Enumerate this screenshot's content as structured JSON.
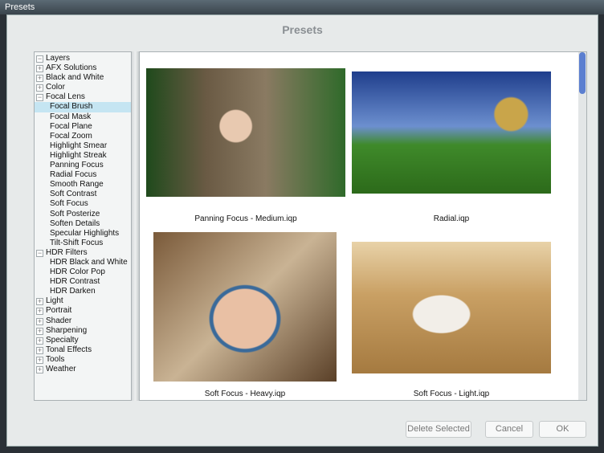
{
  "window": {
    "title": "Presets"
  },
  "dialog": {
    "title": "Presets"
  },
  "tree": [
    {
      "label": "Layers",
      "level": 0,
      "exp": "−"
    },
    {
      "label": "AFX Solutions",
      "level": 0,
      "exp": "+"
    },
    {
      "label": "Black and White",
      "level": 0,
      "exp": "+"
    },
    {
      "label": "Color",
      "level": 0,
      "exp": "+"
    },
    {
      "label": "Focal Lens",
      "level": 0,
      "exp": "−"
    },
    {
      "label": "Focal Brush",
      "level": 1,
      "selected": true
    },
    {
      "label": "Focal Mask",
      "level": 1
    },
    {
      "label": "Focal Plane",
      "level": 1
    },
    {
      "label": "Focal Zoom",
      "level": 1
    },
    {
      "label": "Highlight Smear",
      "level": 1
    },
    {
      "label": "Highlight Streak",
      "level": 1
    },
    {
      "label": "Panning Focus",
      "level": 1
    },
    {
      "label": "Radial Focus",
      "level": 1
    },
    {
      "label": "Smooth Range",
      "level": 1
    },
    {
      "label": "Soft Contrast",
      "level": 1
    },
    {
      "label": "Soft Focus",
      "level": 1
    },
    {
      "label": "Soft Posterize",
      "level": 1
    },
    {
      "label": "Soften Details",
      "level": 1
    },
    {
      "label": "Specular Highlights",
      "level": 1
    },
    {
      "label": "Tilt-Shift Focus",
      "level": 1
    },
    {
      "label": "HDR Filters",
      "level": 0,
      "exp": "−"
    },
    {
      "label": "HDR Black and White",
      "level": 1
    },
    {
      "label": "HDR Color Pop",
      "level": 1
    },
    {
      "label": "HDR Contrast",
      "level": 1
    },
    {
      "label": "HDR Darken",
      "level": 1
    },
    {
      "label": "Light",
      "level": 0,
      "exp": "+"
    },
    {
      "label": "Portrait",
      "level": 0,
      "exp": "+"
    },
    {
      "label": "Shader",
      "level": 0,
      "exp": "+"
    },
    {
      "label": "Sharpening",
      "level": 0,
      "exp": "+"
    },
    {
      "label": "Specialty",
      "level": 0,
      "exp": "+"
    },
    {
      "label": "Tonal Effects",
      "level": 0,
      "exp": "+"
    },
    {
      "label": "Tools",
      "level": 0,
      "exp": "+"
    },
    {
      "label": "Weather",
      "level": 0,
      "exp": "+"
    }
  ],
  "presets": [
    {
      "caption": "Panning Focus - Medium.iqp"
    },
    {
      "caption": "Radial.iqp"
    },
    {
      "caption": "Soft Focus - Heavy.iqp"
    },
    {
      "caption": "Soft Focus - Light.iqp"
    }
  ],
  "buttons": {
    "delete": "Delete Selected",
    "cancel": "Cancel",
    "ok": "OK"
  }
}
